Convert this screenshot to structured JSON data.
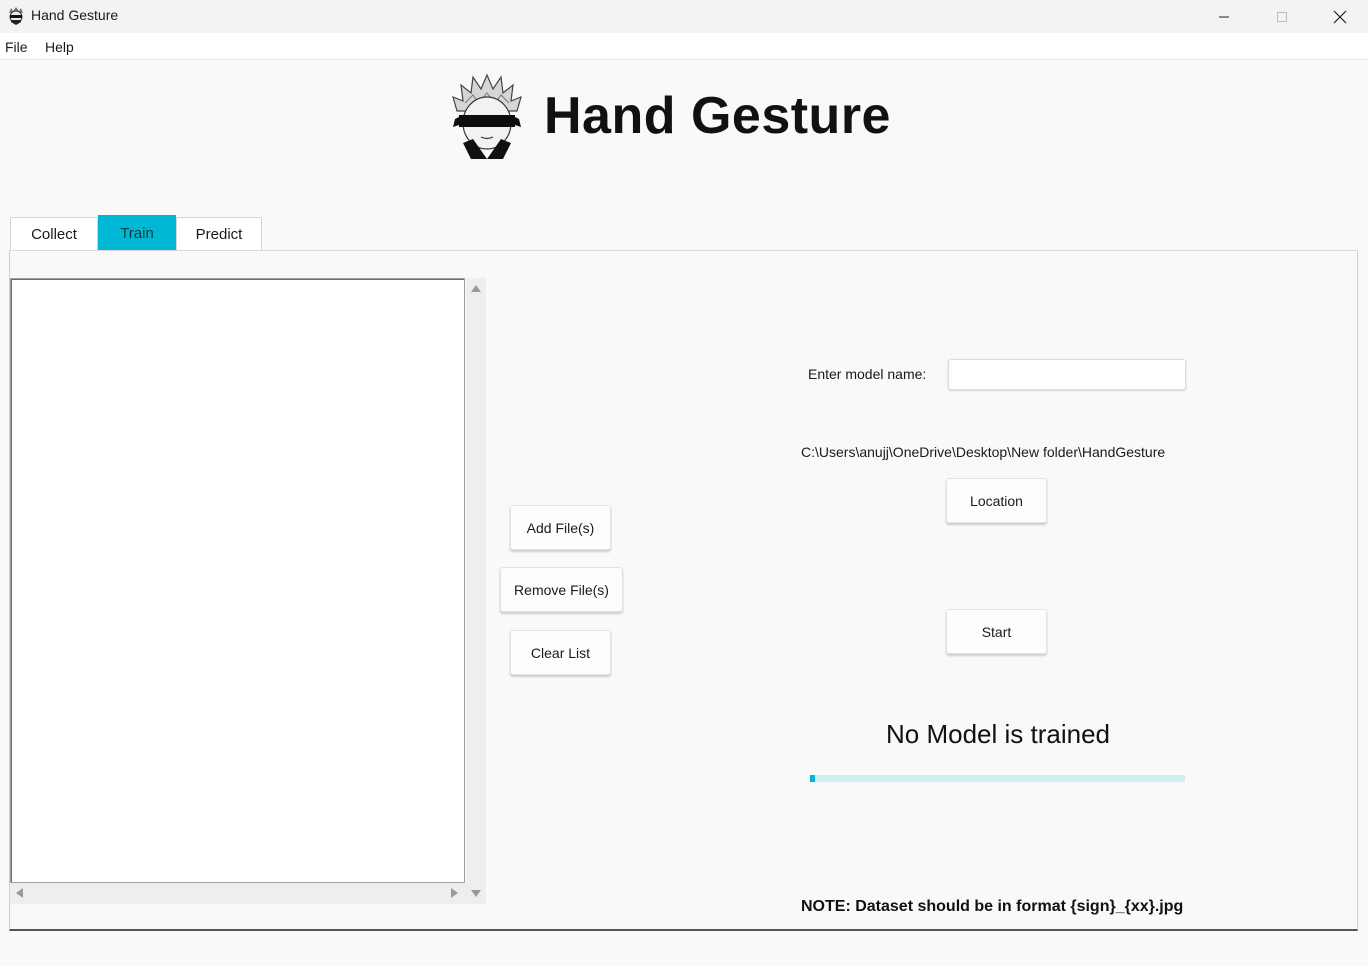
{
  "window": {
    "title": "Hand Gesture",
    "icon": "app-logo-icon",
    "controls": [
      "minimize-icon",
      "maximize-icon",
      "close-icon"
    ]
  },
  "menu": {
    "file": "File",
    "help": "Help"
  },
  "header": {
    "title": "Hand Gesture",
    "logo": "anime-character-logo"
  },
  "tabs": [
    {
      "label": "Collect",
      "active": false
    },
    {
      "label": "Train",
      "active": true
    },
    {
      "label": "Predict",
      "active": false
    }
  ],
  "train": {
    "file_list": [],
    "buttons": {
      "add": "Add File(s)",
      "remove": "Remove File(s)",
      "clear": "Clear List",
      "location": "Location",
      "start": "Start"
    },
    "model_name_label": "Enter model name:",
    "model_name_value": "",
    "path": "C:\\Users\\anujj\\OneDrive\\Desktop\\New folder\\HandGesture",
    "status": "No Model is trained",
    "progress": 0.01,
    "note": "NOTE: Dataset should be in format {sign}_{xx}.jpg"
  },
  "colors": {
    "accent": "#00b8d4",
    "progress_track": "#cfeef4",
    "background": "#f9f9f9"
  }
}
